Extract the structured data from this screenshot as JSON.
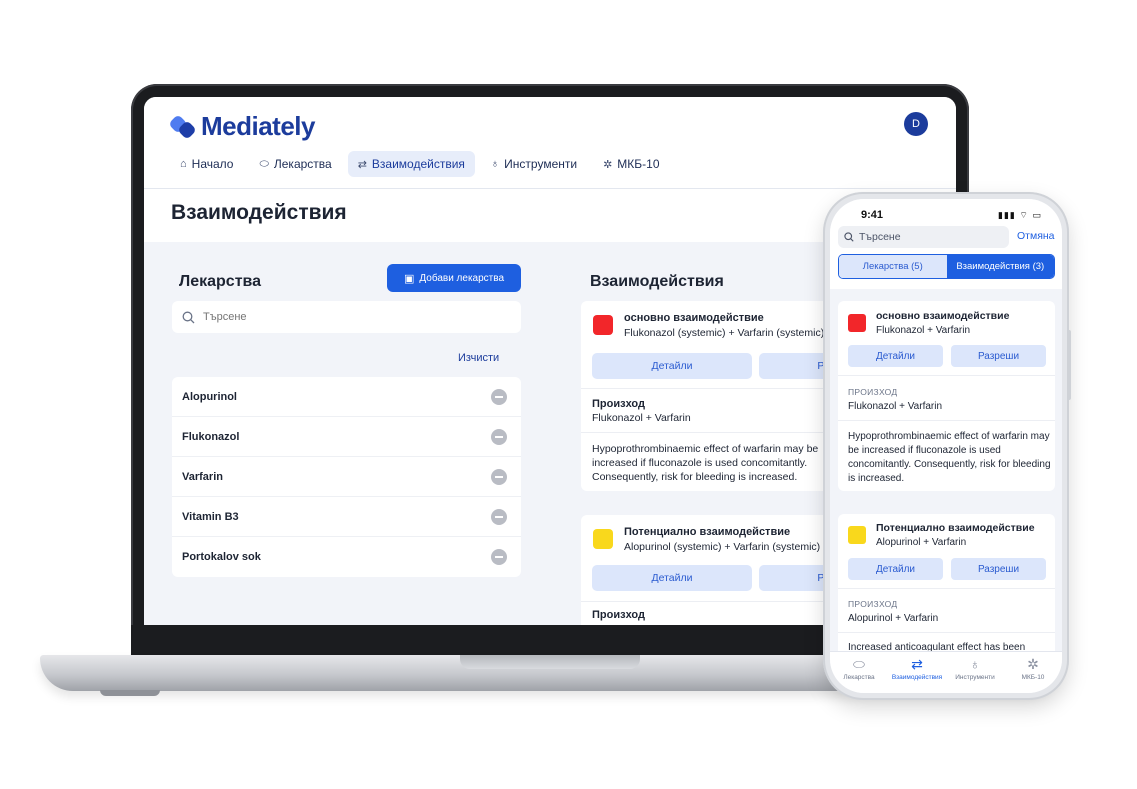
{
  "app": {
    "logo_text": "Mediately",
    "avatar_initial": "D"
  },
  "nav": [
    {
      "label": "Начало",
      "icon": "home-icon"
    },
    {
      "label": "Лекарства",
      "icon": "pill-icon"
    },
    {
      "label": "Взаимодействия",
      "icon": "interaction-arrows-icon"
    },
    {
      "label": "Инструменти",
      "icon": "stethoscope-icon"
    },
    {
      "label": "МКБ-10",
      "icon": "gear-icon"
    }
  ],
  "page_title": "Взаимодействия",
  "drugs_panel": {
    "title": "Лекарства",
    "add_button": "Добави лекарства",
    "search_placeholder": "Търсене",
    "clear_link": "Изчисти",
    "items": [
      "Alopurinol",
      "Flukonazol",
      "Varfarin",
      "Vitamin B3",
      "Portokalov sok"
    ]
  },
  "interactions_panel": {
    "title": "Взаимодействия",
    "cards": [
      {
        "severity": "основно взаимодействие",
        "severity_color": "#f2262a",
        "pair": "Flukonazol (systemic) + Varfarin (systemic)",
        "details_button": "Детайли",
        "resolve_button": "Разреши",
        "origin_label": "Произход",
        "origin_value": "Flukonazol + Varfarin",
        "description": "Hypoprothrombinaemic effect of warfarin may be increased if fluconazole is used concomitantly. Consequently, risk for bleeding is increased."
      },
      {
        "severity": "Потенциално взаимодействие",
        "severity_color": "#f9d81c",
        "pair": "Alopurinol (systemic) + Varfarin (systemic)",
        "details_button": "Детайли",
        "resolve_button": "Разреши",
        "origin_label": "Произход"
      }
    ]
  },
  "phone": {
    "time": "9:41",
    "status_icons": "▮▮▮ ⌔ ▭",
    "search_placeholder": "Търсене",
    "cancel": "Отмяна",
    "seg_drugs": "Лекарства (5)",
    "seg_interactions": "Взаимодействия (3)",
    "cards": [
      {
        "severity": "основно взаимодействие",
        "pair": "Flukonazol + Varfarin",
        "details_button": "Детайли",
        "resolve_button": "Разреши",
        "origin_label": "ПРОИЗХОД",
        "origin_value": "Flukonazol + Varfarin",
        "description": "Hypoprothrombinaemic effect of warfarin may be increased if fluconazole is used concomitantly. Consequently, risk for bleeding is increased."
      },
      {
        "severity": "Потенциално взаимодействие",
        "pair": "Alopurinol + Varfarin",
        "details_button": "Детайли",
        "resolve_button": "Разреши",
        "origin_label": "ПРОИЗХОД",
        "origin_value": "Alopurinol + Varfarin",
        "description": "Increased anticoagulant effect has been"
      }
    ],
    "tabs": [
      {
        "label": "Лекарства",
        "icon": "pill-icon"
      },
      {
        "label": "Взаимодействия",
        "icon": "interaction-arrows-icon"
      },
      {
        "label": "Инструменти",
        "icon": "stethoscope-icon"
      },
      {
        "label": "МКБ-10",
        "icon": "gear-icon"
      }
    ]
  },
  "colors": {
    "brand": "#1c3c9c",
    "accent": "#1e5fe0",
    "danger": "#f2262a",
    "warning": "#f9d81c"
  }
}
